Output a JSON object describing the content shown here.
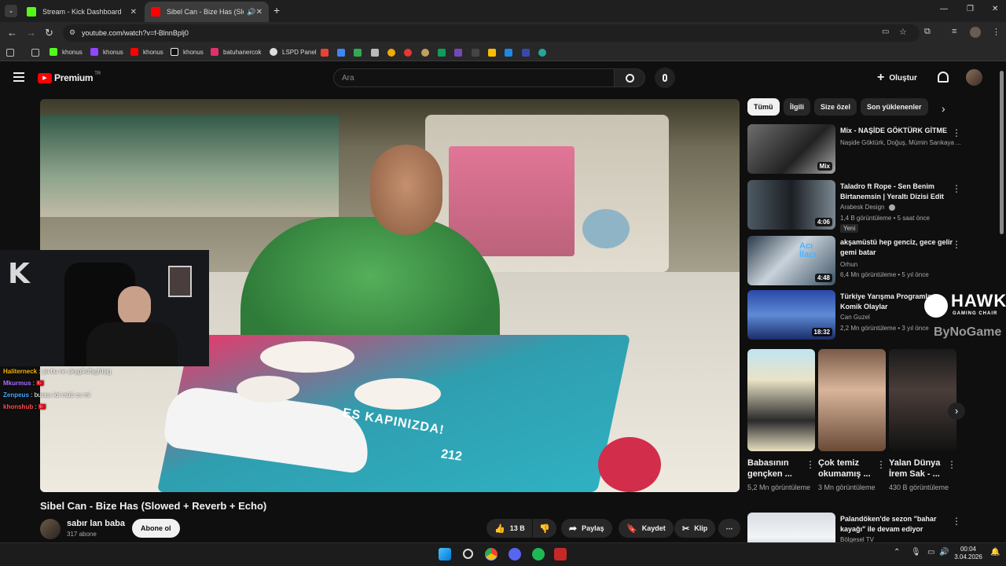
{
  "browser": {
    "tabs": [
      {
        "title": "Stream - Kick Dashboard",
        "icon": "kick-icon",
        "active": false
      },
      {
        "title": "Sibel Can - Bize Has (Slowe",
        "icon": "youtube-icon",
        "active": true
      }
    ],
    "url": "youtube.com/watch?v=f-BlnnBplj0",
    "bookmarks": [
      {
        "label": "khonus",
        "icon": "kick-icon",
        "color": "#53fc18"
      },
      {
        "label": "khonus",
        "icon": "twitch-icon",
        "color": "#9146ff"
      },
      {
        "label": "khonus",
        "icon": "youtube-icon",
        "color": "#ff0000"
      },
      {
        "label": "khonus",
        "icon": "x-icon",
        "color": "#ffffff"
      },
      {
        "label": "batuhanercok",
        "icon": "instagram-icon",
        "color": "#e1306c"
      },
      {
        "label": "LSPD Panel",
        "icon": "lspd-icon",
        "color": "#dddddd"
      }
    ]
  },
  "youtube": {
    "logo_text": "Premium",
    "logo_badge": "TR",
    "search_placeholder": "Ara",
    "create_label": "Oluştur",
    "chips": [
      "Tümü",
      "İlgili",
      "Size özel",
      "Son yüklenenler"
    ],
    "video": {
      "title": "Sibel Can - Bize Has (Slowed + Reverb + Echo)",
      "channel": "sabır lan baba",
      "subscribers": "317 abone",
      "subscribe_label": "Abone ol",
      "likes": "13 B",
      "share_label": "Paylaş",
      "save_label": "Kaydet",
      "clip_label": "Klip"
    },
    "stream_chat": [
      {
        "user": "Haliterneck",
        "message": "ya bu ne şkşgfkdfşgfdşlg",
        "color": "#f5b400"
      },
      {
        "user": "Mkurmus",
        "message": "🇹🇷",
        "color": "#a970ff"
      },
      {
        "user": "Zenpeus",
        "message": "burası lol müü cs mi",
        "color": "#3ea6ff"
      },
      {
        "user": "khonshub",
        "message": "🇹🇷",
        "color": "#ff4d4d"
      }
    ],
    "overlay_brand": {
      "name": "HAWK",
      "sub": "GAMING CHAIR",
      "sponsor": "ByNoGame"
    },
    "recommendations": [
      {
        "title": "Mix - NAŞİDE GÖKTÜRK GİTME",
        "channel": "Naşide Göktürk, Doğuş, Mümin Sarıkaya ...",
        "meta": "",
        "badge_text": "Mix",
        "new_label": ""
      },
      {
        "title": "Taladro ft Rope - Sen Benim Birtanemsin | Yeraltı Dizisi Edit",
        "channel": "Arabesk Design",
        "meta": "1,4 B görüntüleme • 5 saat önce",
        "badge_text": "4:06",
        "new_label": "Yeni"
      },
      {
        "title": "akşamüstü hep genciz, gece gelir gemi batar",
        "channel": "Orhun",
        "meta": "6,4 Mn görüntüleme • 5 yıl önce",
        "badge_text": "4:48",
        "new_label": ""
      },
      {
        "title": "Türkiye Yarışma Programları Komik Olaylar",
        "channel": "Can Guzel",
        "meta": "2,2 Mn görüntüleme • 3 yıl önce",
        "badge_text": "18:32",
        "new_label": ""
      }
    ],
    "shorts": [
      {
        "title": "Babasının gençken ...",
        "views": "5,2 Mn görüntüleme"
      },
      {
        "title": "Çok temiz okumamış ...",
        "views": "3 Mn görüntüleme"
      },
      {
        "title": "Yalan Dünya İrem Sak - ...",
        "views": "430 B görüntüleme"
      }
    ],
    "next_rec": {
      "title": "Palandöken'de sezon \"bahar kayağı\" ile devam ediyor",
      "channel": "Bölgesel TV"
    },
    "video_overlay_text": "ES KAPINIZDA!",
    "plate_number": "212"
  },
  "taskbar": {
    "time": "00:04",
    "date": "3.04.2026"
  }
}
